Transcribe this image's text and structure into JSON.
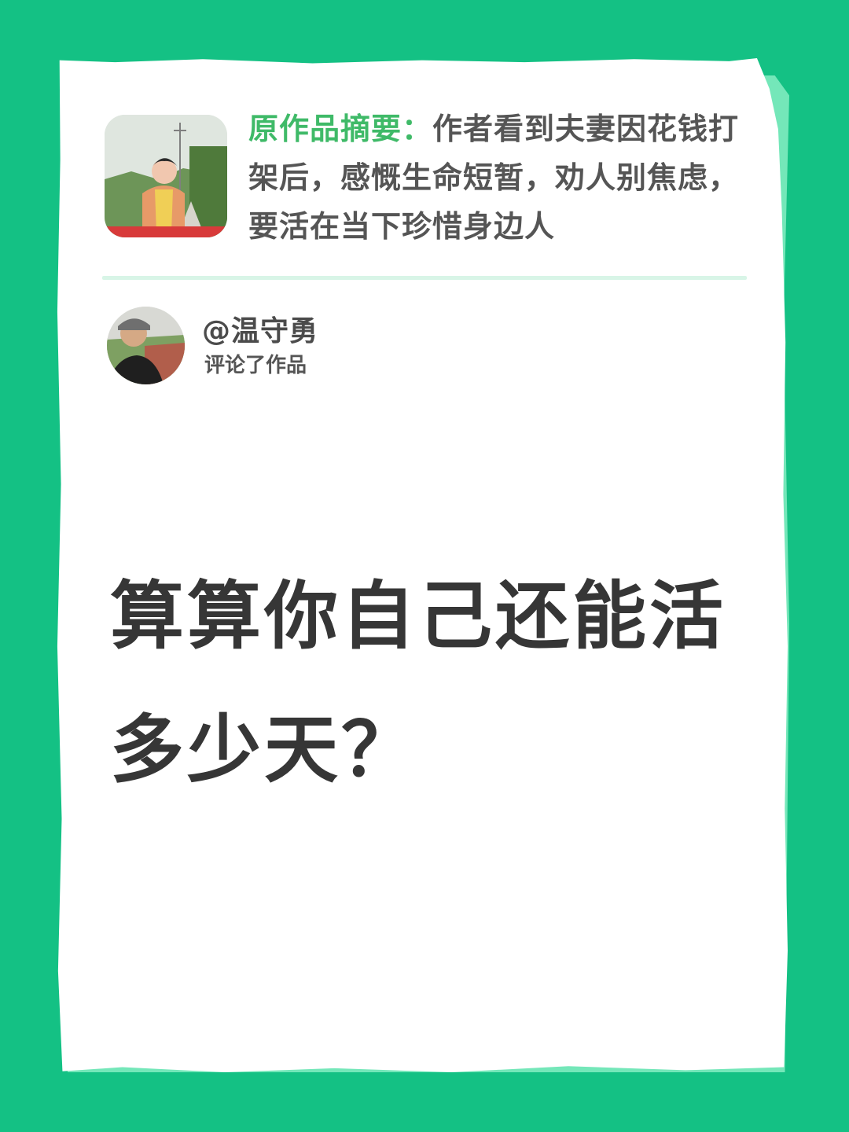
{
  "summary": {
    "label": "原作品摘要：",
    "text": "作者看到夫妻因花钱打架后，感慨生命短暂，劝人别焦虑，要活在当下珍惜身边人"
  },
  "commenter": {
    "username": "@温守勇",
    "action": "评论了作品"
  },
  "comment": {
    "text": "算算你自己还能活多少天？"
  }
}
